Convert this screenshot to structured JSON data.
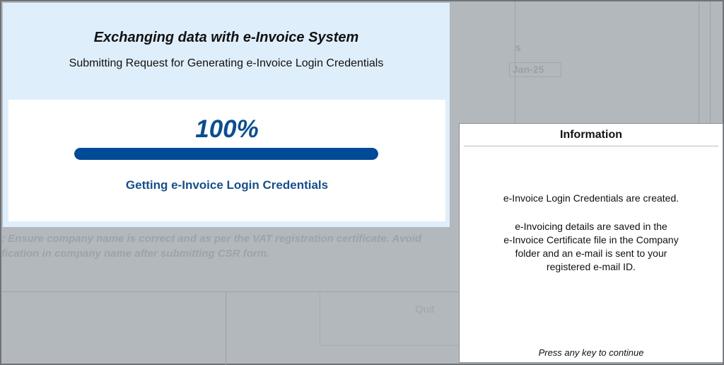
{
  "background": {
    "field_label": "s",
    "field_value": "Jan-25",
    "note_lines": [
      ": Ensure company name is correct and as per the VAT registration certificate. Avoid",
      "fication in company name after submitting CSR form."
    ],
    "quit_label": "Quit"
  },
  "progress_dialog": {
    "title": "Exchanging data with e-Invoice System",
    "subtitle": "Submitting Request for Generating e-Invoice Login Credentials",
    "percent_text": "100%",
    "progress_fraction": 1.0,
    "status": "Getting e-Invoice Login Credentials"
  },
  "info_dialog": {
    "title": "Information",
    "message": "e-Invoice Login Credentials are created.",
    "details_lines": [
      "e-Invoicing details are saved in the",
      "e-Invoice Certificate file in the Company",
      "folder and an e-mail is sent to your",
      "registered e-mail ID."
    ],
    "footer": "Press any key to continue"
  },
  "colors": {
    "accent": "#004a97",
    "dialog_header_bg": "#dfeefb",
    "dimmed_bg": "#b3b8bd"
  }
}
